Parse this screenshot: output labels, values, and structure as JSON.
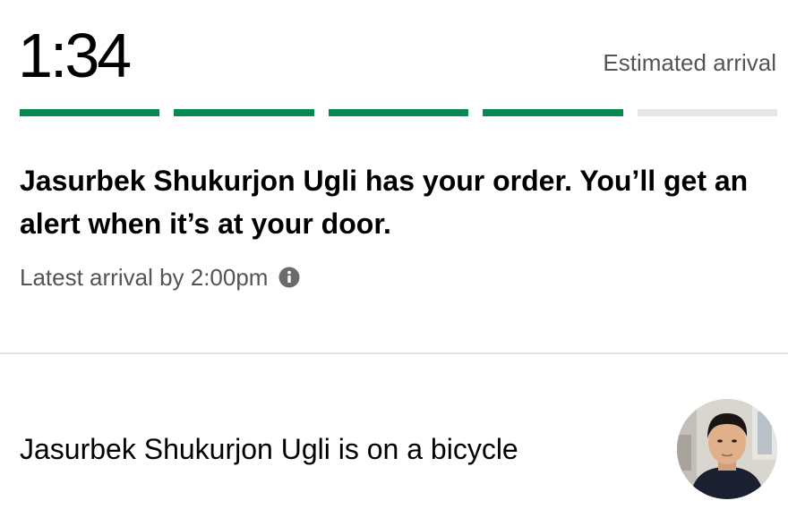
{
  "eta": {
    "time": "1:34",
    "label": "Estimated arrival"
  },
  "progress": {
    "completed_steps": 4,
    "total_steps": 5,
    "complete_color": "#06894e",
    "pending_color": "#e6e6e6"
  },
  "status": {
    "message": "Jasurbek Shukurjon Ugli has your order. You’ll get an alert when it’s at your door.",
    "latest_arrival": "Latest arrival by 2:00pm",
    "info_icon": "info-icon"
  },
  "courier": {
    "description": "Jasurbek Shukurjon Ugli is on a bicycle",
    "avatar_icon": "courier-avatar"
  }
}
